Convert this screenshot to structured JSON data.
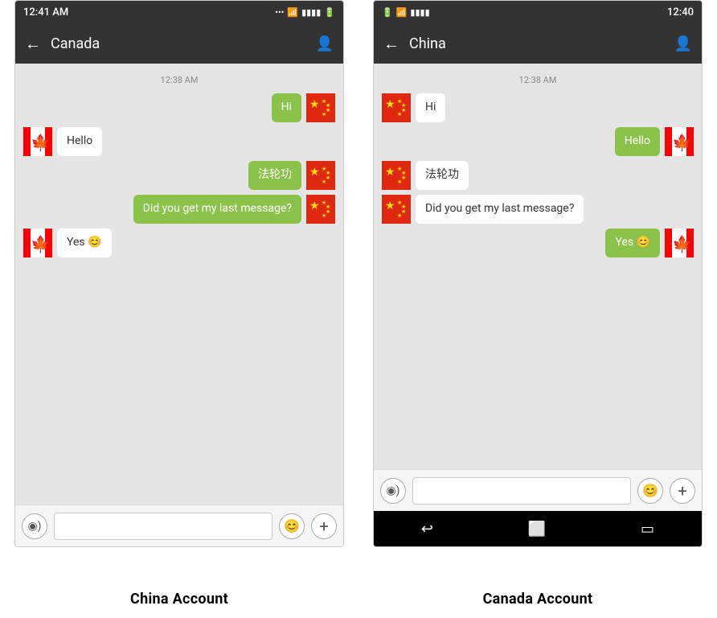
{
  "left_phone": {
    "status_bar": {
      "time": "12:41 AM",
      "icons": "... ◉ ▲ ▮▮▮▮ □"
    },
    "nav": {
      "back": "←",
      "title": "Canada",
      "profile": "👤"
    },
    "timestamp": "12:38 AM",
    "messages": [
      {
        "id": 1,
        "text": "Hi",
        "type": "sent",
        "flag": "cn"
      },
      {
        "id": 2,
        "text": "Hello",
        "type": "received",
        "flag": "ca"
      },
      {
        "id": 3,
        "text": "法轮功",
        "type": "sent",
        "flag": "cn"
      },
      {
        "id": 4,
        "text": "Did you get my last message?",
        "type": "sent",
        "flag": "cn"
      },
      {
        "id": 5,
        "text": "Yes 😊",
        "type": "received",
        "flag": "ca"
      }
    ],
    "input": {
      "voice_icon": "◉)",
      "placeholder": "",
      "emoji_icon": "😊",
      "add_icon": "+"
    }
  },
  "right_phone": {
    "status_bar": {
      "time": "12:40",
      "icons": "□ ◉ △ ▮▮▮▮"
    },
    "nav": {
      "back": "←",
      "title": "China",
      "profile": "👤"
    },
    "timestamp": "12:38 AM",
    "messages": [
      {
        "id": 1,
        "text": "Hi",
        "type": "received",
        "flag": "cn"
      },
      {
        "id": 2,
        "text": "Hello",
        "type": "sent",
        "flag": "ca"
      },
      {
        "id": 3,
        "text": "法轮功",
        "type": "received",
        "flag": "cn"
      },
      {
        "id": 4,
        "text": "Did you get my last message?",
        "type": "received",
        "flag": "cn"
      },
      {
        "id": 5,
        "text": "Yes 😊",
        "type": "sent",
        "flag": "ca"
      }
    ],
    "input": {
      "voice_icon": "◉)",
      "placeholder": "",
      "emoji_icon": "😊",
      "add_icon": "+"
    },
    "android_nav": [
      "↩",
      "⬜",
      "▭"
    ]
  },
  "captions": {
    "left": "China Account",
    "right": "Canada Account"
  }
}
